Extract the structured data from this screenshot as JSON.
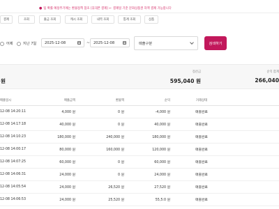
{
  "notice": {
    "text_left": "팁 확률 예정주기에는 환불정책 참조 [휴대폰 결제] ←",
    "text_right": "결제일 기준 문화상품권 차액 결제 가능합니다"
  },
  "tabs": [
    "결제",
    "조회",
    "출금 조회",
    "캐시 조회",
    "내역 조회",
    "통계 조회",
    "상품"
  ],
  "filter": {
    "radio_today": "어제",
    "radio_week": "지난 7일",
    "date_from": "2025-12-08",
    "date_to": "2025-12-08",
    "category_placeholder": "매출구분",
    "search_button": "검색하기"
  },
  "summary": [
    {
      "label": "",
      "value": "원"
    },
    {
      "label": "정산금",
      "value": "595,040 원"
    },
    {
      "label": "순익 합계",
      "value": "266,040"
    }
  ],
  "table": {
    "headers": [
      "매출일시",
      "매출금액",
      "환불액",
      "순익",
      "거래상태"
    ],
    "rows": [
      [
        "12-08 14:20:11",
        "4,000 원",
        "0 원",
        "-4,000 원",
        "매출완료"
      ],
      [
        "12-08 14:17:18",
        "40,000 원",
        "0 원",
        "40,000 원",
        "매출완료"
      ],
      [
        "12-08 14:10:23",
        "180,000 원",
        "240,000 원",
        "180,000 원",
        "매출완료"
      ],
      [
        "12-08 14:00:17",
        "80,000 원",
        "160,000 원",
        "120,000 원",
        "매출완료"
      ],
      [
        "12-08 14:07:25",
        "60,000 원",
        "0 원",
        "60,000 원",
        "매출완료"
      ],
      [
        "12-08 14:06:31",
        "24,000 원",
        "0 원",
        "24,000 원",
        "매출완료"
      ],
      [
        "12-08 14:05:54",
        "24,000 원",
        "26,520 원",
        "27,520 원",
        "매출완료"
      ],
      [
        "12-08 14:06:53",
        "24,000 원",
        "25,520 원",
        "55,5:0 원",
        "매출완료"
      ]
    ]
  }
}
